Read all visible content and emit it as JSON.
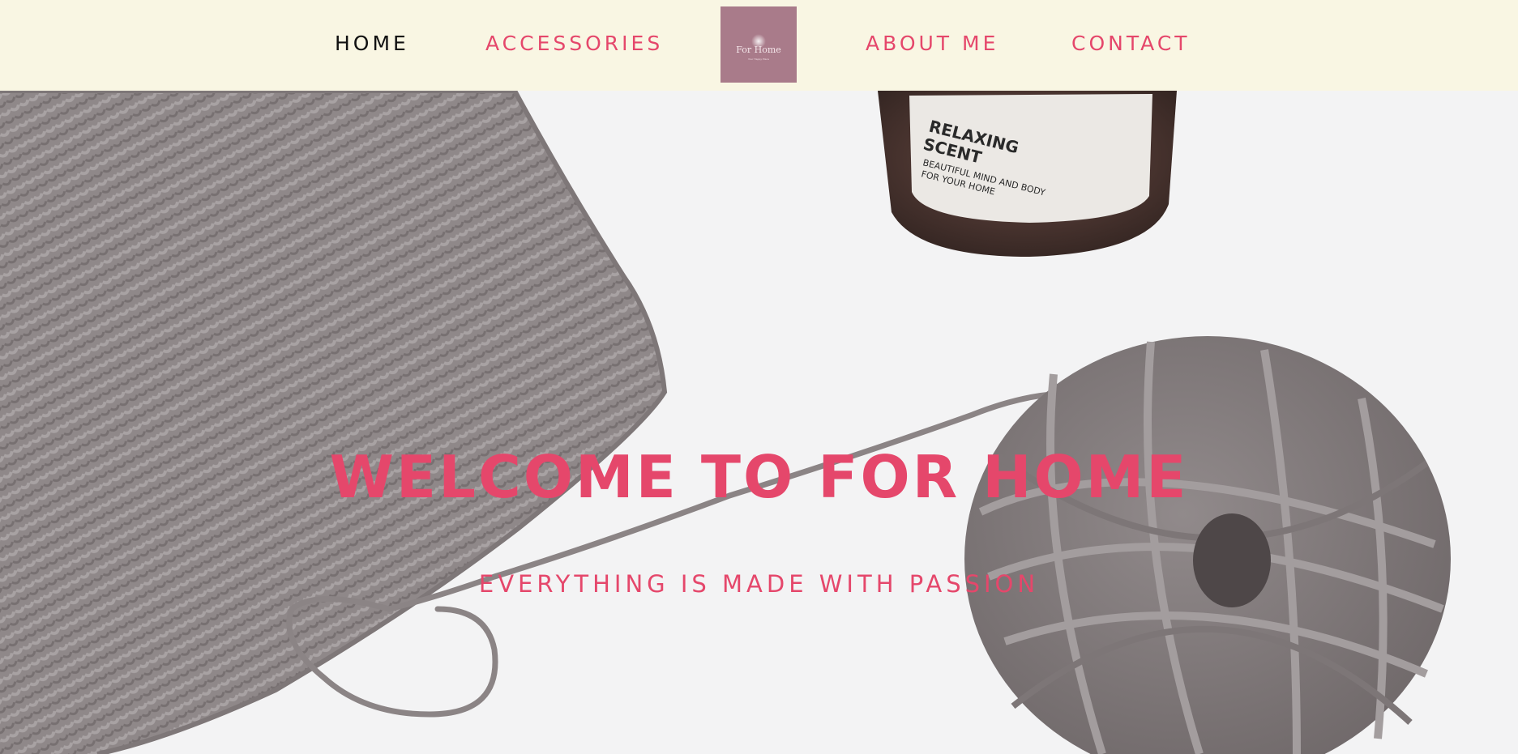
{
  "nav": {
    "items": [
      {
        "label": "HOME",
        "active": true
      },
      {
        "label": "ACCESSORIES",
        "active": false
      },
      {
        "label": "ABOUT ME",
        "active": false
      },
      {
        "label": "CONTACT",
        "active": false
      }
    ],
    "logo": {
      "title": "For Home",
      "tagline": "Your Happy Place"
    }
  },
  "hero": {
    "title": "WELCOME TO FOR HOME",
    "subtitle": "EVERYTHING IS MADE WITH PASSION",
    "jar_label": {
      "line1": "RELAXING",
      "line2": "SCENT",
      "line3": "BEAUTIFUL MIND AND BODY",
      "line4": "FOR YOUR HOME"
    }
  },
  "colors": {
    "accent": "#e5476b",
    "header_bg": "#f9f6e3",
    "active_nav": "#111111",
    "logo_bg": "#a97b8a",
    "yarn": "#8e8788"
  }
}
